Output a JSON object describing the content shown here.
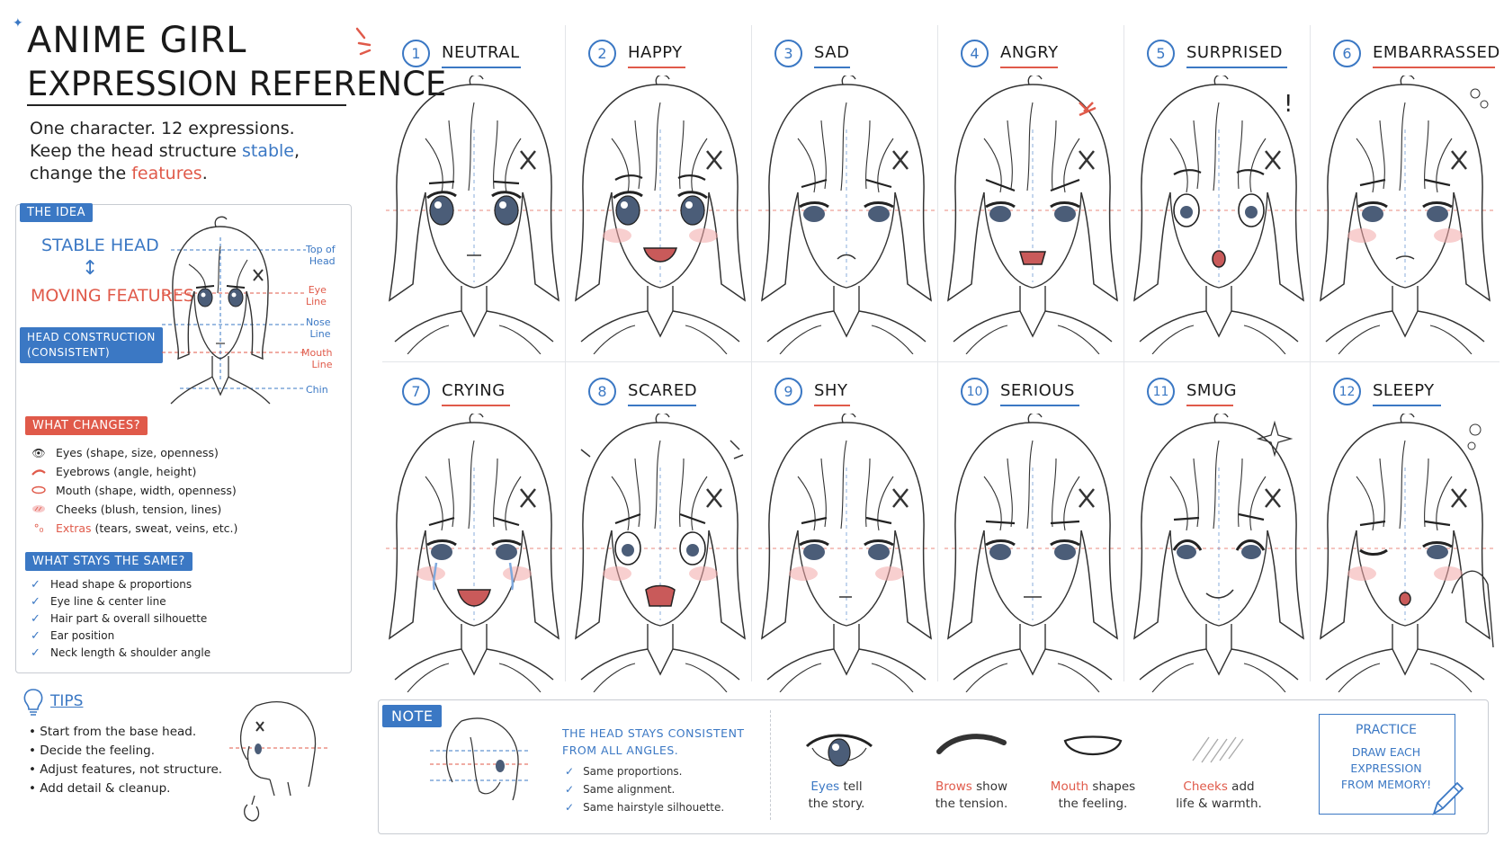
{
  "title": {
    "line1": "ANIME GIRL",
    "line2": "EXPRESSION REFERENCE"
  },
  "subtitle": {
    "line1": "One character. 12 expressions.",
    "line2_pre": "Keep the head structure ",
    "line2_accent": "stable",
    "line2_post": ",",
    "line3_pre": "change the ",
    "line3_accent": "features",
    "line3_post": "."
  },
  "idea": {
    "tag": "THE IDEA",
    "stable": "STABLE HEAD",
    "arrow": "↕",
    "moving": "MOVING FEATURES",
    "construction_line1": "HEAD CONSTRUCTION",
    "construction_line2": "(CONSISTENT)",
    "guides": {
      "top_line1": "Top of",
      "top_line2": "Head",
      "eye_line1": "Eye",
      "eye_line2": "Line",
      "nose_line1": "Nose",
      "nose_line2": "Line",
      "mouth_line1": "Mouth",
      "mouth_line2": "Line",
      "chin": "Chin"
    }
  },
  "what_changes": {
    "tag": "WHAT CHANGES?",
    "items": [
      {
        "icon": "eye-icon",
        "label": "Eyes (shape, size, openness)",
        "accent": ""
      },
      {
        "icon": "eyebrow-icon",
        "label": "Eyebrows (angle, height)",
        "accent": ""
      },
      {
        "icon": "mouth-icon",
        "label": "Mouth (shape, width, openness)",
        "accent": ""
      },
      {
        "icon": "cheek-icon",
        "label": "Cheeks (blush, tension, lines)",
        "accent": ""
      },
      {
        "icon": "drops-icon",
        "label": " (tears, sweat, veins, etc.)",
        "accent": "Extras"
      }
    ]
  },
  "what_stays": {
    "tag": "WHAT STAYS THE SAME?",
    "items": [
      "Head shape & proportions",
      "Eye line & center line",
      "Hair part & overall silhouette",
      "Ear position",
      "Neck length & shoulder angle"
    ]
  },
  "tips": {
    "label": "TIPS",
    "items": [
      "Start from the base head.",
      "Decide the feeling.",
      "Adjust features, not structure.",
      "Add detail & cleanup."
    ]
  },
  "expressions": [
    {
      "num": "1",
      "name": "NEUTRAL",
      "ul": "#3b78c4"
    },
    {
      "num": "2",
      "name": "HAPPY",
      "ul": "#e05a4a"
    },
    {
      "num": "3",
      "name": "SAD",
      "ul": "#3b78c4"
    },
    {
      "num": "4",
      "name": "ANGRY",
      "ul": "#e05a4a"
    },
    {
      "num": "5",
      "name": "SURPRISED",
      "ul": "#3b78c4"
    },
    {
      "num": "6",
      "name": "EMBARRASSED",
      "ul": "#e05a4a"
    },
    {
      "num": "7",
      "name": "CRYING",
      "ul": "#e05a4a"
    },
    {
      "num": "8",
      "name": "SCARED",
      "ul": "#3b78c4"
    },
    {
      "num": "9",
      "name": "SHY",
      "ul": "#e05a4a"
    },
    {
      "num": "10",
      "name": "SERIOUS",
      "ul": "#3b78c4"
    },
    {
      "num": "11",
      "name": "SMUG",
      "ul": "#e05a4a"
    },
    {
      "num": "12",
      "name": "SLEEPY",
      "ul": "#3b78c4"
    }
  ],
  "note": {
    "tag": "NOTE",
    "title_line1": "THE HEAD STAYS CONSISTENT",
    "title_line2": "FROM ALL ANGLES.",
    "items": [
      "Same proportions.",
      "Same alignment.",
      "Same hairstyle silhouette."
    ],
    "features": [
      {
        "accent": "Eyes",
        "rest1": " tell",
        "line2": "the story.",
        "color": "#3b78c4"
      },
      {
        "accent": "Brows",
        "rest1": " show",
        "line2": "the tension.",
        "color": "#e05a4a"
      },
      {
        "accent": "Mouth",
        "rest1": " shapes",
        "line2": "the feeling.",
        "color": "#e05a4a"
      },
      {
        "accent": "Cheeks",
        "rest1": " add",
        "line2": "life & warmth.",
        "color": "#e05a4a"
      }
    ],
    "practice_title": "PRACTICE",
    "practice_line1": "DRAW EACH",
    "practice_line2": "EXPRESSION",
    "practice_line3": "FROM MEMORY!"
  },
  "colors": {
    "blue": "#3b78c4",
    "red": "#e05a4a",
    "blush": "#f3a7a7"
  }
}
